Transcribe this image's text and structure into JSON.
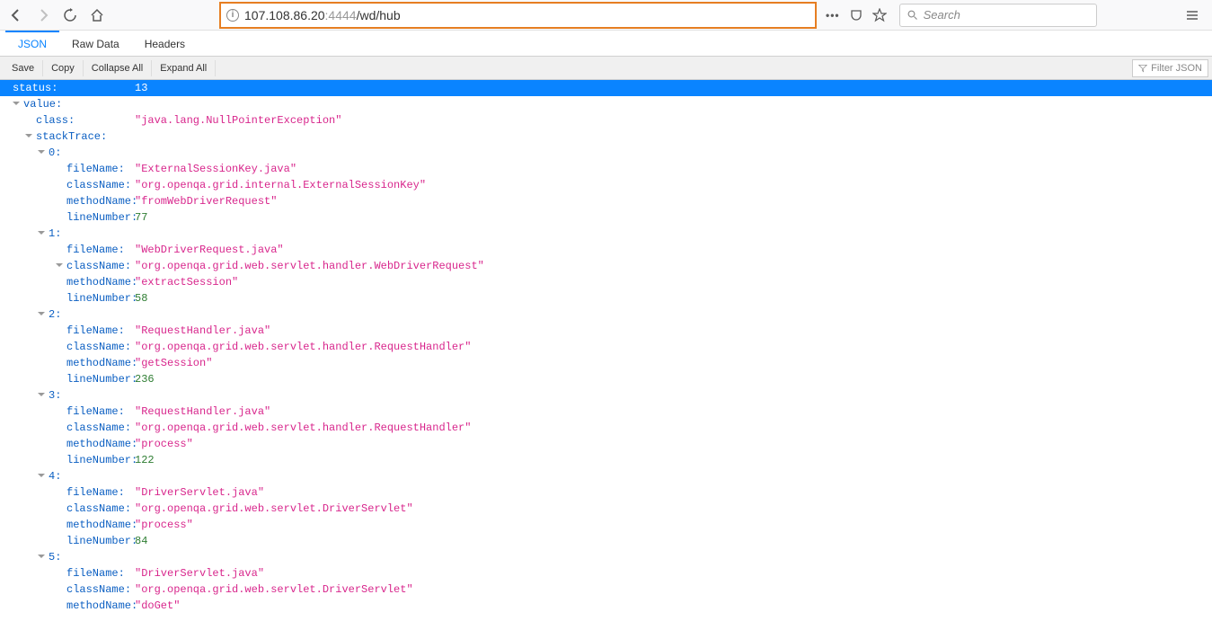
{
  "nav": {
    "url_dim1": "107.108.86.20",
    "url_dim2": ":4444",
    "url_rest": "/wd/hub",
    "search_placeholder": "Search"
  },
  "tabs": {
    "json": "JSON",
    "raw": "Raw Data",
    "headers": "Headers"
  },
  "actions": {
    "save": "Save",
    "copy": "Copy",
    "collapse": "Collapse All",
    "expand": "Expand All",
    "filter": "Filter JSON"
  },
  "json": {
    "status_key": "status",
    "status_val": "13",
    "value_key": "value",
    "class_key": "class",
    "stacktrace_key": "stackTrace",
    "filename_key": "fileName",
    "classname_key": "className",
    "methodname_key": "methodName",
    "linenumber_key": "lineNumber",
    "class_val": "\"java.lang.NullPointerException\"",
    "idx0": "0",
    "idx1": "1",
    "idx2": "2",
    "idx3": "3",
    "idx4": "4",
    "idx5": "5",
    "frames": [
      {
        "fileName": "\"ExternalSessionKey.java\"",
        "className": "\"org.openqa.grid.internal.ExternalSessionKey\"",
        "methodName": "\"fromWebDriverRequest\"",
        "lineNumber": "77"
      },
      {
        "fileName": "\"WebDriverRequest.java\"",
        "className": "\"org.openqa.grid.web.servlet.handler.WebDriverRequest\"",
        "methodName": "\"extractSession\"",
        "lineNumber": "58"
      },
      {
        "fileName": "\"RequestHandler.java\"",
        "className": "\"org.openqa.grid.web.servlet.handler.RequestHandler\"",
        "methodName": "\"getSession\"",
        "lineNumber": "236"
      },
      {
        "fileName": "\"RequestHandler.java\"",
        "className": "\"org.openqa.grid.web.servlet.handler.RequestHandler\"",
        "methodName": "\"process\"",
        "lineNumber": "122"
      },
      {
        "fileName": "\"DriverServlet.java\"",
        "className": "\"org.openqa.grid.web.servlet.DriverServlet\"",
        "methodName": "\"process\"",
        "lineNumber": "84"
      },
      {
        "fileName": "\"DriverServlet.java\"",
        "className": "\"org.openqa.grid.web.servlet.DriverServlet\"",
        "methodName": "\"doGet\""
      }
    ]
  }
}
